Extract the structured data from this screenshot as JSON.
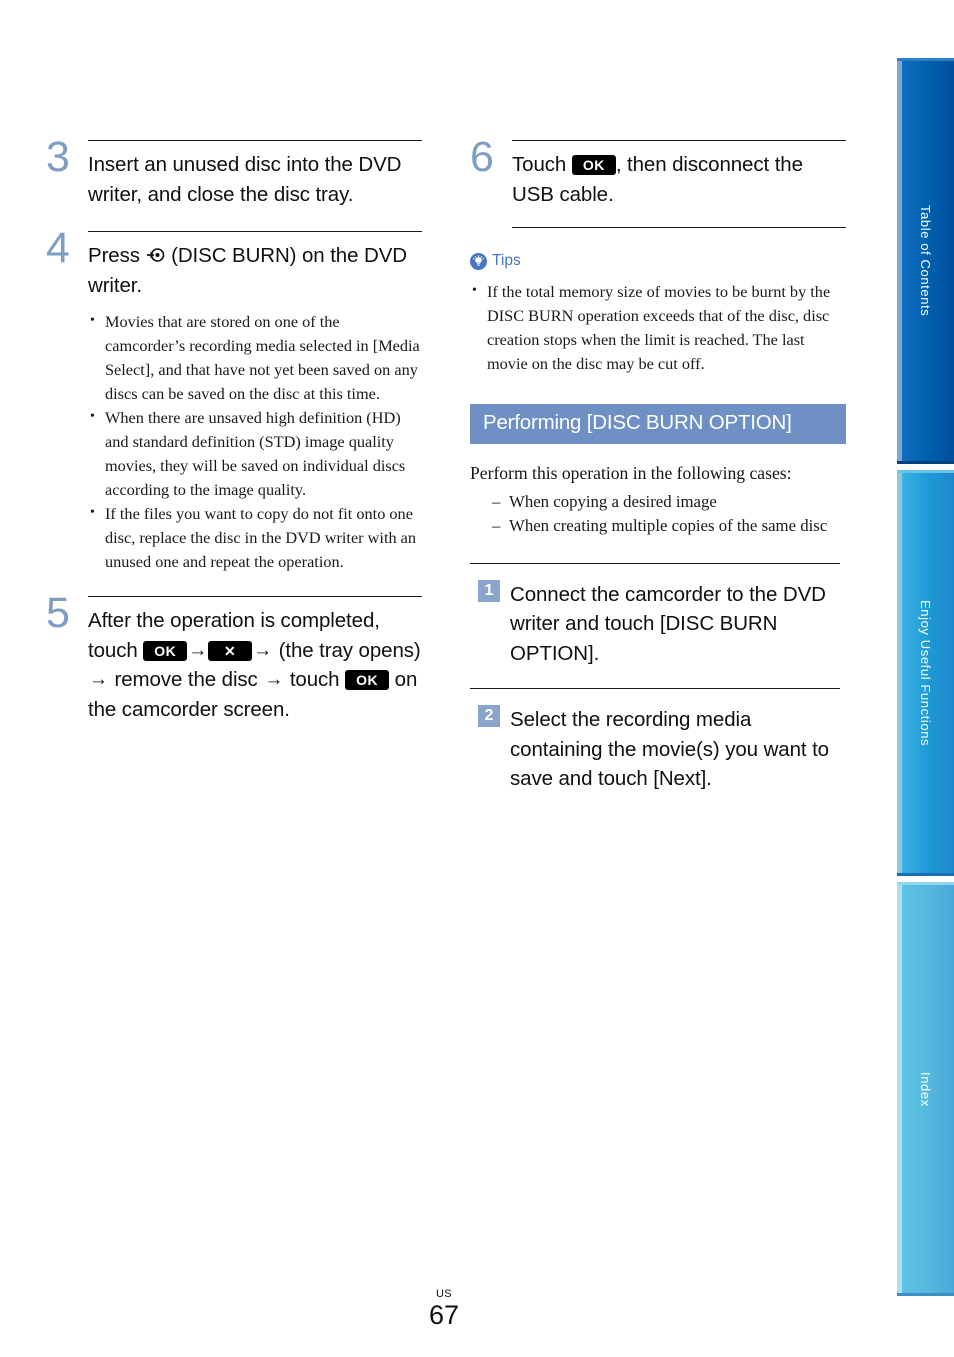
{
  "page": {
    "country_code": "US",
    "page_number": "67"
  },
  "left_column": {
    "steps": [
      {
        "number": "3",
        "text": "Insert an unused disc into the DVD writer, and close the disc tray."
      },
      {
        "number": "4",
        "text_before_icon": "Press ",
        "icon": "disc-burn-icon",
        "text_after_icon": " (DISC BURN) on the DVD writer.",
        "notes": [
          "Movies that are stored on one of the camcorder’s recording media selected in [Media Select], and that have not yet been saved on any discs can be saved on the disc at this time.",
          "When there are unsaved high definition (HD) and standard definition (STD) image quality movies, they will be saved on individual discs according to the image quality.",
          "If the files you want to copy do not fit onto one disc, replace the disc in the DVD writer with an unused one and repeat the operation."
        ]
      },
      {
        "number": "5",
        "segments": [
          {
            "kind": "text",
            "value": "After the operation is completed, touch "
          },
          {
            "kind": "button",
            "value": "OK"
          },
          {
            "kind": "arrow",
            "value": "→"
          },
          {
            "kind": "button",
            "value": "✕"
          },
          {
            "kind": "arrow",
            "value": "→"
          },
          {
            "kind": "text",
            "value": " (the tray opens) "
          },
          {
            "kind": "arrow",
            "value": "→"
          },
          {
            "kind": "text",
            "value": " remove the disc "
          },
          {
            "kind": "arrow",
            "value": "→"
          },
          {
            "kind": "text",
            "value": " touch "
          },
          {
            "kind": "button",
            "value": "OK"
          },
          {
            "kind": "text",
            "value": " on the camcorder screen."
          }
        ]
      }
    ]
  },
  "right_column": {
    "step6": {
      "number": "6",
      "text_before_button": "Touch ",
      "button_label": "OK",
      "text_after_button": ", then disconnect the USB cable."
    },
    "tips": {
      "icon": "lightbulb-icon",
      "label": "Tips",
      "items": [
        "If the total memory size of movies to be burnt by the DISC BURN operation exceeds that of the disc, disc creation stops when the limit is reached. The last movie on the disc may be cut off."
      ]
    },
    "section": {
      "heading": "Performing [DISC BURN OPTION]",
      "intro": "Perform this operation in the following cases:",
      "cases": [
        "When copying a desired image",
        "When creating multiple copies of the same disc"
      ],
      "steps": [
        {
          "badge": "1",
          "text": "Connect the camcorder to the DVD writer and touch [DISC BURN OPTION]."
        },
        {
          "badge": "2",
          "text": "Select the recording media containing the movie(s) you want to save and touch [Next]."
        }
      ]
    }
  },
  "side_tabs": [
    {
      "label": "Table of Contents",
      "color": "#00509c"
    },
    {
      "label": "Enjoy Useful Functions",
      "color": "#1f88cc"
    },
    {
      "label": "Index",
      "color": "#4aa8d8"
    }
  ]
}
